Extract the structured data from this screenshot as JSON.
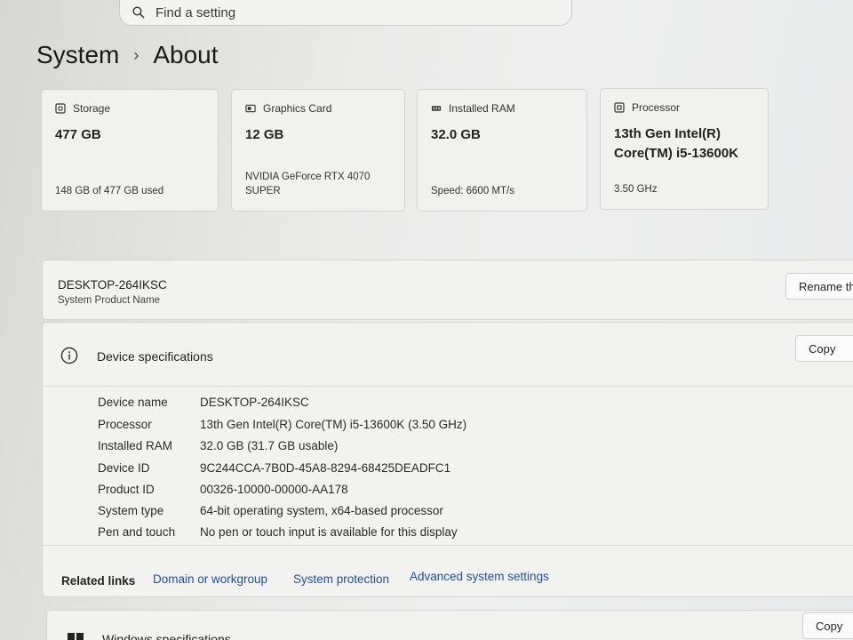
{
  "search": {
    "placeholder": "Find a setting"
  },
  "breadcrumb": {
    "parent": "System",
    "separator": "›",
    "current": "About"
  },
  "cards": [
    {
      "icon": "storage-icon",
      "label": "Storage",
      "value": "477 GB",
      "detail": "148 GB of 477 GB used"
    },
    {
      "icon": "graphics-card-icon",
      "label": "Graphics Card",
      "value": "12 GB",
      "detail": "NVIDIA GeForce RTX 4070 SUPER"
    },
    {
      "icon": "ram-icon",
      "label": "Installed RAM",
      "value": "32.0 GB",
      "detail": "Speed: 6600 MT/s"
    },
    {
      "icon": "processor-icon",
      "label": "Processor",
      "value": "13th Gen Intel(R) Core(TM) i5-13600K",
      "detail": "3.50 GHz"
    }
  ],
  "device": {
    "name": "DESKTOP-264IKSC",
    "subtitle": "System Product Name",
    "rename_label": "Rename this PC"
  },
  "specs": {
    "title": "Device specifications",
    "copy_label": "Copy",
    "rows": [
      {
        "key": "Device name",
        "value": "DESKTOP-264IKSC"
      },
      {
        "key": "Processor",
        "value": "13th Gen Intel(R) Core(TM) i5-13600K (3.50 GHz)"
      },
      {
        "key": "Installed RAM",
        "value": "32.0 GB (31.7 GB usable)"
      },
      {
        "key": "Device ID",
        "value": "9C244CCA-7B0D-45A8-8294-68425DEADFC1"
      },
      {
        "key": "Product ID",
        "value": "00326-10000-00000-AA178"
      },
      {
        "key": "System type",
        "value": "64-bit operating system, x64-based processor"
      },
      {
        "key": "Pen and touch",
        "value": "No pen or touch input is available for this display"
      }
    ]
  },
  "related": {
    "label": "Related links",
    "links": [
      "Domain or workgroup",
      "System protection",
      "Advanced system settings"
    ]
  },
  "windows_specs": {
    "title": "Windows specifications",
    "copy_label": "Copy"
  }
}
